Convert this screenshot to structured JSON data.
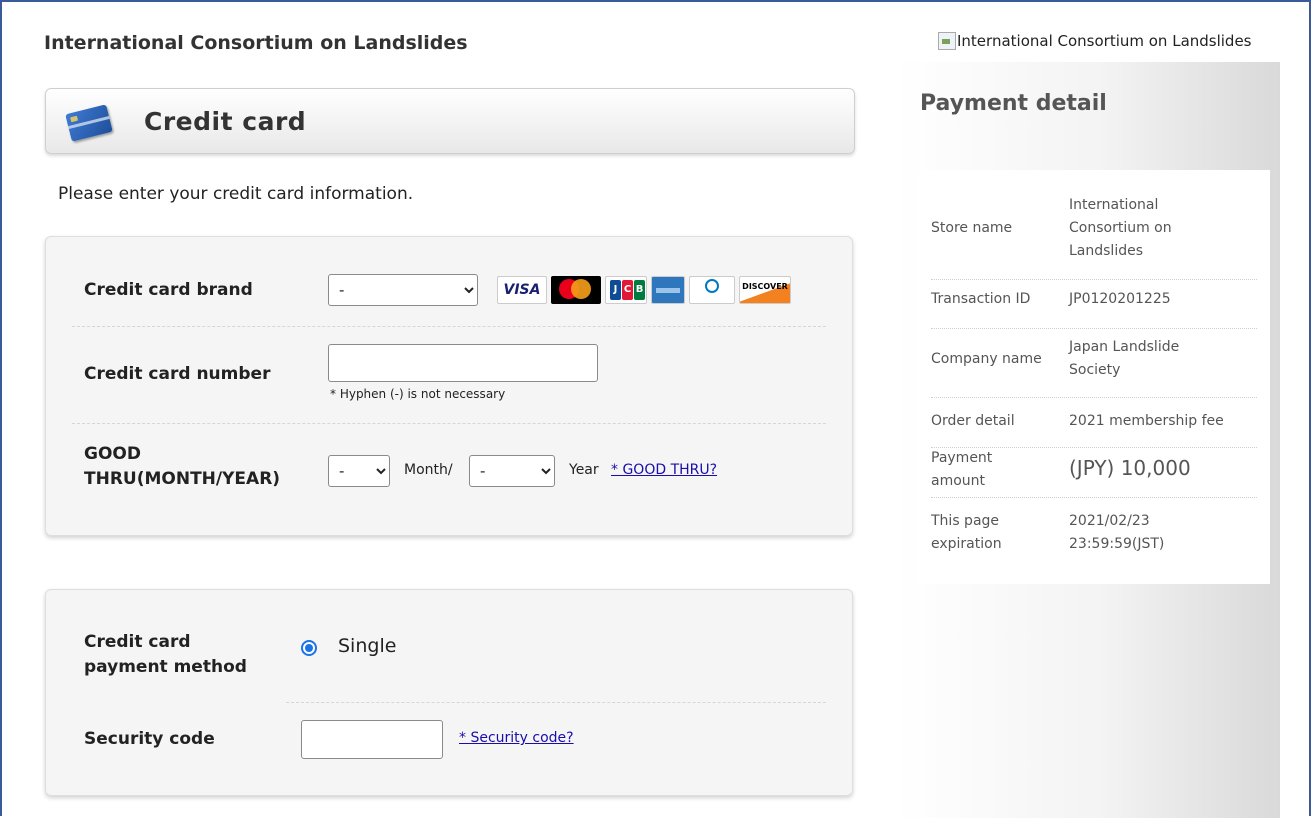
{
  "header": {
    "site_title": "International Consortium on Landslides",
    "logo_alt": "International Consortium on Landslides"
  },
  "main": {
    "section_title": "Credit card",
    "instruction": "Please enter your credit card information.",
    "card_brand": {
      "label": "Credit card brand",
      "selected": "-",
      "brands": [
        "VISA",
        "mastercard",
        "JCB",
        "AMERICAN EXPRESS",
        "Diners Club",
        "DISCOVER"
      ]
    },
    "card_number": {
      "label": "Credit card number",
      "value": "",
      "note": "* Hyphen (-) is not necessary"
    },
    "good_thru": {
      "label_line1": "GOOD",
      "label_line2": "THRU(MONTH/YEAR)",
      "month_selected": "-",
      "month_suffix": "Month/",
      "year_selected": "-",
      "year_suffix": "Year",
      "help_link": "* GOOD THRU?"
    },
    "payment_method": {
      "label_line1": "Credit card",
      "label_line2": "payment method",
      "option": "Single",
      "checked": true
    },
    "security_code": {
      "label": "Security code",
      "value": "",
      "help_link": "* Security code?"
    }
  },
  "sidebar": {
    "title": "Payment detail",
    "rows": [
      {
        "key": "Store name",
        "value_lines": [
          "International",
          "Consortium on",
          "Landslides"
        ]
      },
      {
        "key": "Transaction ID",
        "value_lines": [
          "JP0120201225"
        ]
      },
      {
        "key": "Company name",
        "value_lines": [
          "Japan Landslide",
          "Society"
        ]
      },
      {
        "key": "Order detail",
        "value_lines": [
          "2021 membership fee"
        ]
      },
      {
        "key_lines": [
          "Payment",
          "amount"
        ],
        "value": "(JPY) 10,000"
      },
      {
        "key_lines": [
          "This page",
          "expiration"
        ],
        "value_lines": [
          "2021/02/23",
          "23:59:59(JST)"
        ]
      }
    ]
  },
  "colors": {
    "link": "#1a0dab",
    "radio_accent": "#1a73e8",
    "frame_border": "#3b5a9a"
  }
}
